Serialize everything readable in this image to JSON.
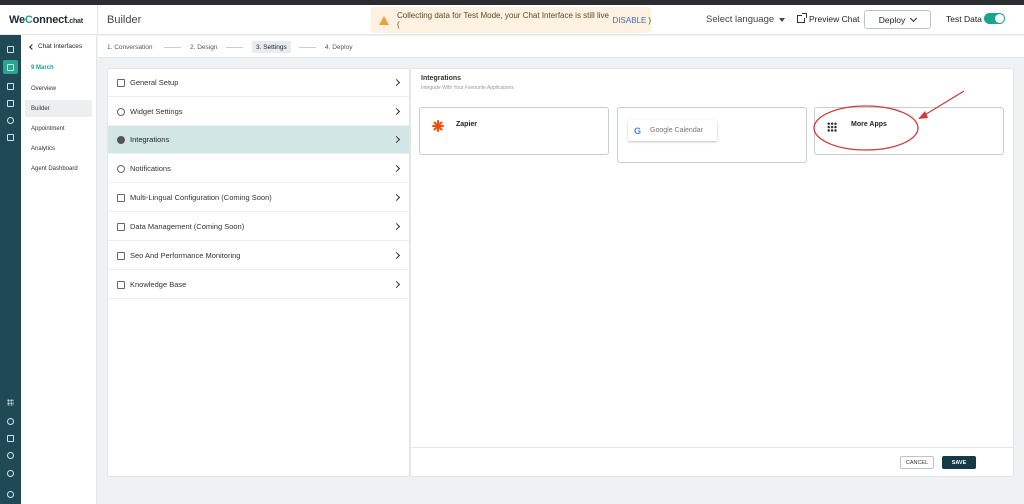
{
  "app": {
    "logo_prefix": "We",
    "logo_c": "C",
    "logo_rest": "onnect",
    "logo_tld": ".chat",
    "page_title": "Builder"
  },
  "banner": {
    "text": "Collecting data for Test Mode, your Chat Interface is still live (",
    "action": "DISABLE",
    "close_paren": ")"
  },
  "header": {
    "language_label": "Select language",
    "preview_label": "Preview Chat",
    "deploy_label": "Deploy",
    "test_data_label": "Test Data",
    "test_data_on": true
  },
  "subnav": {
    "back_label": "Chat Interfaces",
    "date": "9 March",
    "items": [
      {
        "label": "Overview"
      },
      {
        "label": "Builder"
      },
      {
        "label": "Appointment"
      },
      {
        "label": "Analytics"
      },
      {
        "label": "Agent Dashboard"
      }
    ]
  },
  "steps": [
    {
      "label": "1. Conversation"
    },
    {
      "label": "2. Design"
    },
    {
      "label": "3. Settings"
    },
    {
      "label": "4. Deploy"
    }
  ],
  "settings_menu": [
    {
      "label": "General Setup",
      "icon": "edit-icon"
    },
    {
      "label": "Widget Settings",
      "icon": "gear-icon"
    },
    {
      "label": "Integrations",
      "icon": "globe-icon"
    },
    {
      "label": "Notifications",
      "icon": "bell-icon"
    },
    {
      "label": "Multi-Lingual Configuration (Coming Soon)",
      "icon": "sliders-icon"
    },
    {
      "label": "Data Management (Coming Soon)",
      "icon": "database-icon"
    },
    {
      "label": "Seo And Performance Monitoring",
      "icon": "sliders-icon"
    },
    {
      "label": "Knowledge Base",
      "icon": "book-icon"
    }
  ],
  "integrations": {
    "title": "Integrations",
    "subtitle": "Integrate With Your Favourite Applications",
    "cards": [
      {
        "label": "Zapier"
      },
      {
        "label": "Google Calendar"
      },
      {
        "label": "More Apps"
      }
    ]
  },
  "footer": {
    "cancel_label": "CANCEL",
    "save_label": "SAVE"
  },
  "colors": {
    "accent": "#1aa38f",
    "rail": "#1f4a55",
    "save": "#133a45",
    "active_menu": "#d3e6e6",
    "annotation": "#d9383a"
  }
}
